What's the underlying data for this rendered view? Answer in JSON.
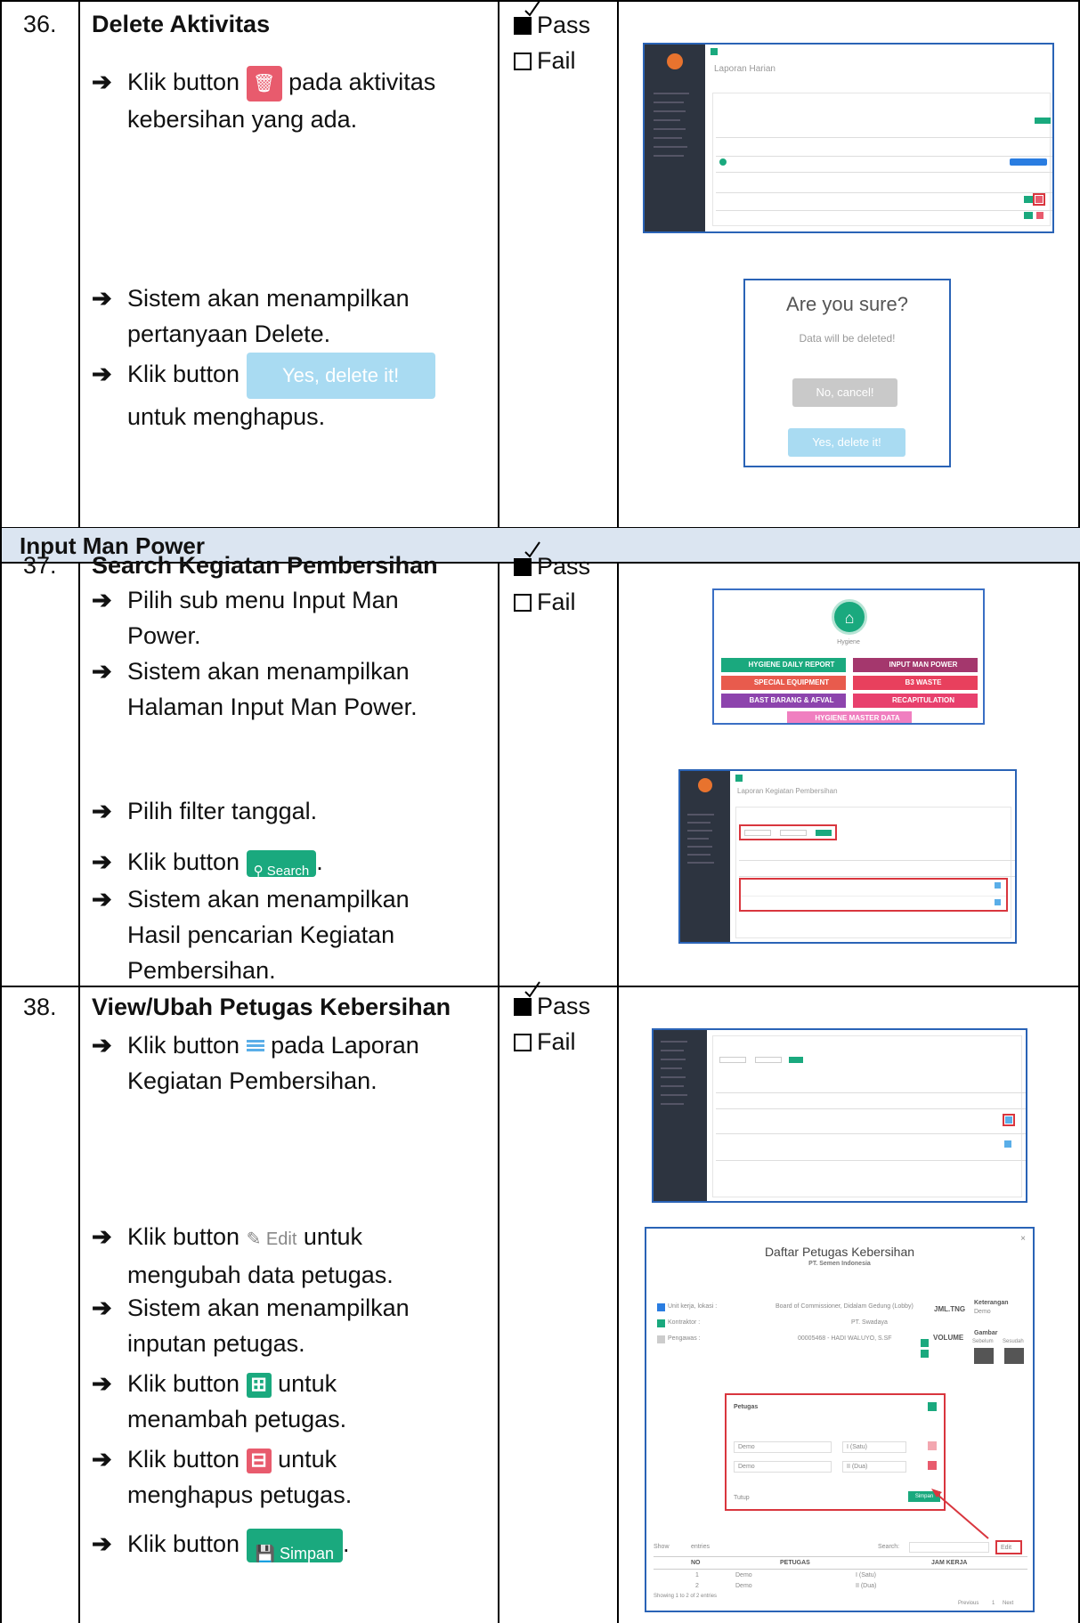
{
  "rows": [
    {
      "number": "36.",
      "title": "Delete Aktivitas",
      "steps": [
        {
          "pre": "Klik button",
          "post": "pada aktivitas",
          "cont": "kebersihan yang ada."
        },
        {
          "line1": "Sistem akan menampilkan",
          "cont": "pertanyaan Delete."
        },
        {
          "pre": "Klik button",
          "button": "Yes, delete it!",
          "cont": "untuk menghapus."
        }
      ],
      "status": {
        "pass": "Pass",
        "fail": "Fail"
      },
      "modal": {
        "title": "Are you sure?",
        "message": "Data will be deleted!",
        "cancel": "No, cancel!",
        "confirm": "Yes, delete it!"
      },
      "report_title": "Laporan Harian"
    },
    {
      "section": "Input Man Power"
    },
    {
      "number": "37.",
      "title": "Search Kegiatan Pembersihan",
      "steps": [
        {
          "line1": "Pilih sub menu Input Man",
          "cont": "Power."
        },
        {
          "line1": "Sistem akan menampilkan",
          "cont": "Halaman Input Man Power."
        },
        {
          "line1": "Pilih filter tanggal."
        },
        {
          "pre": "Klik button",
          "button": "Search",
          "post": "."
        },
        {
          "line1": "Sistem akan menampilkan",
          "cont": "Hasil pencarian Kegiatan",
          "cont2": "Pembersihan."
        }
      ],
      "status": {
        "pass": "Pass",
        "fail": "Fail"
      },
      "menu_label": "Hygiene",
      "tiles": [
        {
          "label": "HYGIENE DAILY REPORT",
          "color": "#1aa97e"
        },
        {
          "label": "INPUT MAN POWER",
          "color": "#a4376d"
        },
        {
          "label": "SPECIAL EQUIPMENT",
          "color": "#e85b4d"
        },
        {
          "label": "B3 WASTE",
          "color": "#e8405d"
        },
        {
          "label": "BAST BARANG & AFVAL",
          "color": "#8d44ad"
        },
        {
          "label": "RECAPITULATION",
          "color": "#e8406d"
        },
        {
          "label": "HYGIENE MASTER DATA",
          "color": "#f07fc0"
        }
      ],
      "page_title": "Laporan Kegiatan Pembersihan"
    },
    {
      "number": "38.",
      "title": "View/Ubah Petugas Kebersihan",
      "steps": [
        {
          "pre": "Klik button",
          "post": "pada Laporan",
          "cont": "Kegiatan Pembersihan."
        },
        {
          "pre": "Klik button",
          "button": "Edit",
          "post": "untuk",
          "cont": "mengubah data petugas."
        },
        {
          "line1": "Sistem akan menampilkan",
          "cont": "inputan petugas."
        },
        {
          "pre": "Klik button",
          "post": "untuk",
          "cont": "menambah petugas."
        },
        {
          "pre": "Klik button",
          "post": "untuk",
          "cont": "menghapus petugas."
        },
        {
          "pre": "Klik button",
          "button": "Simpan",
          "post": "."
        }
      ],
      "status": {
        "pass": "Pass",
        "fail": "Fail"
      },
      "dialog": {
        "title": "Daftar Petugas Kebersihan",
        "subtitle": "PT. Semen Indonesia",
        "unit_label": "Unit kerja, lokasi :",
        "unit_value": "Board of Commissioner, Didalam Gedung (Lobby)",
        "kontraktor_label": "Kontraktor :",
        "kontraktor_value": "PT. Swadaya",
        "pengawas_label": "Pengawas :",
        "pengawas_value": "00005468 - HADI WALUYO, S.SF",
        "jml_label": "JML.TNG",
        "volume_label": "VOLUME",
        "keterangan_label": "Keterangan",
        "keterangan_value": "Demo",
        "gambar_label": "Gambar",
        "sebelum": "Sebelum",
        "sesudah": "Sesudah",
        "petugas_label": "Petugas",
        "petugas_rows": [
          {
            "name": "Demo",
            "jam": "I (Satu)"
          },
          {
            "name": "Demo",
            "jam": "II (Dua)"
          }
        ],
        "tutup": "Tutup",
        "simpan": "Simpan",
        "show": "Show",
        "entries": "entries",
        "search": "Search:",
        "edit": "Edit",
        "col_no": "NO",
        "col_petugas": "PETUGAS",
        "col_jam": "JAM KERJA",
        "table_rows": [
          {
            "no": "1",
            "petugas": "Demo",
            "jam": "I (Satu)"
          },
          {
            "no": "2",
            "petugas": "Demo",
            "jam": "II (Dua)"
          }
        ],
        "showing": "Showing 1 to 2 of 2 entries",
        "previous": "Previous",
        "page": "1",
        "next": "Next"
      }
    }
  ]
}
